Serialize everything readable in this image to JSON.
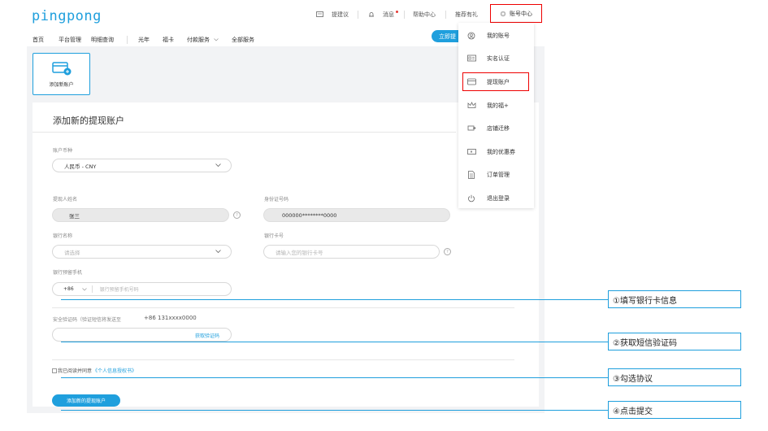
{
  "brand": {
    "logo_text": "pingpong",
    "accent": "#1f9fdd",
    "highlight": "#ee0000"
  },
  "topbar": {
    "feedback": "提建议",
    "messages": "消息",
    "help": "帮助中心",
    "refer": "推荐有礼",
    "account": "账号中心"
  },
  "nav": {
    "items": [
      "首页",
      "平台管理",
      "明细查询",
      "光年",
      "福卡",
      "付款服务",
      "全部服务"
    ],
    "start_button": "立即提"
  },
  "add_card": {
    "label": "添加新账户"
  },
  "form": {
    "title": "添加新的提现账户",
    "currency_label": "账户币种",
    "currency_value": "人民币 - CNY",
    "holder_label": "提现人姓名",
    "holder_value": "张三",
    "id_label": "身份证号码",
    "id_value": "000000********0000",
    "bank_label": "银行名称",
    "bank_placeholder": "请选择",
    "card_label": "银行卡号",
    "card_placeholder": "请输入您的银行卡号",
    "phone_label": "银行预留手机",
    "phone_prefix": "+86",
    "phone_placeholder": "银行预留手机号码",
    "sms_label": "安全验证码（验证短信将发送至",
    "sms_phone": "+86 131xxxx0000",
    "get_code": "获取验证码",
    "agree_prefix": "我已阅读并同意",
    "agree_link": "《个人信息授权书》",
    "submit": "添加新的提现账户"
  },
  "menu": {
    "items": [
      {
        "label": "我的账号",
        "icon": "user-circle-icon"
      },
      {
        "label": "实名认证",
        "icon": "id-card-icon"
      },
      {
        "label": "提现账户",
        "icon": "bank-card-icon"
      },
      {
        "label": "我的福+",
        "icon": "crown-icon"
      },
      {
        "label": "店铺迁移",
        "icon": "store-move-icon"
      },
      {
        "label": "我的优惠券",
        "icon": "coupon-icon"
      },
      {
        "label": "订单管理",
        "icon": "document-icon"
      },
      {
        "label": "退出登录",
        "icon": "power-icon"
      }
    ]
  },
  "annotations": [
    "①填写银行卡信息",
    "②获取短信验证码",
    "③勾选协议",
    "④点击提交"
  ]
}
